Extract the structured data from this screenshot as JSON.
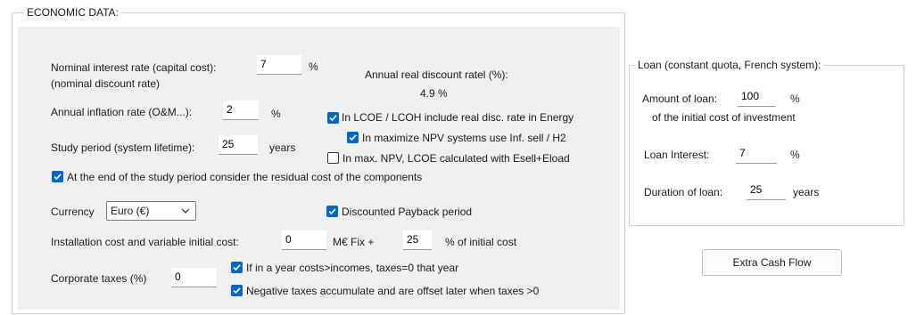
{
  "economic": {
    "group_title": "ECONOMIC DATA:",
    "nominal_interest_label": "Nominal interest rate (capital cost):",
    "nominal_interest_sub": "(nominal discount rate)",
    "nominal_interest_value": "7",
    "pct1": "%",
    "real_discount_label": "Annual real discount ratel (%):",
    "real_discount_value": "4.9 %",
    "inflation_label": "Annual inflation rate  (O&M...):",
    "inflation_value": "2",
    "pct2": "%",
    "cb_lcoe_real_label": "In LCOE / LCOH include real disc. rate in Energy",
    "study_period_label": "Study period (system lifetime):",
    "study_period_value": "25",
    "study_period_unit": "years",
    "cb_max_npv_label": "In maximize NPV systems use  Inf. sell / H2",
    "cb_esell_label": "In max. NPV, LCOE calculated with Esell+Eload",
    "cb_residual_label": "At the end of the study period consider the residual cost of the components",
    "currency_label": "Currency",
    "currency_value": "Euro (€)",
    "cb_payback_label": "Discounted Payback period",
    "install_cost_label": "Installation cost and variable initial cost:",
    "install_fix_value": "0",
    "install_fix_unit": "M€ Fix +",
    "install_pct_value": "25",
    "install_pct_unit": "% of initial cost",
    "corp_tax_label": "Corporate taxes (%)",
    "corp_tax_value": "0",
    "cb_costs_incomes_label": "If in a year costs>incomes, taxes=0 that year",
    "cb_negative_taxes_label": "Negative taxes accumulate and are offset later when taxes >0"
  },
  "loan": {
    "group_title": "Loan (constant quota, French system):",
    "amount_label": "Amount of loan:",
    "amount_value": "100",
    "amount_unit": "%",
    "amount_sub": "of the initial cost of investment",
    "interest_label": "Loan Interest:",
    "interest_value": "7",
    "interest_unit": "%",
    "duration_label": "Duration of loan:",
    "duration_value": "25",
    "duration_unit": "years"
  },
  "buttons": {
    "extra_cash_flow": "Extra Cash Flow"
  },
  "checkboxes": {
    "lcoe_real": true,
    "max_npv": true,
    "esell": false,
    "residual": true,
    "payback": true,
    "costs_incomes": true,
    "negative_taxes": true
  },
  "colors": {
    "accent": "#0067c0",
    "panel": "#f0f0f0"
  }
}
